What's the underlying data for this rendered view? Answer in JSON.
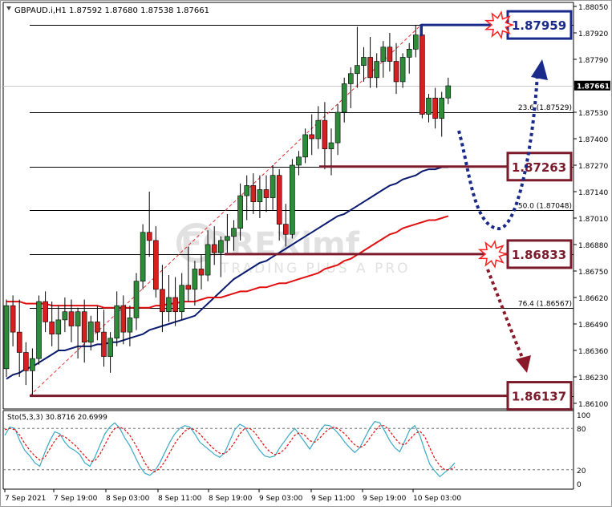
{
  "header": {
    "symbol": "GBPAUD.i,H1",
    "ohlc": "1.87592 1.87680 1.87538 1.87661"
  },
  "watermark": {
    "logo": "FOREXimf",
    "tagline": "TRADING PLUS A PRO"
  },
  "colors": {
    "bull_candle": "#2e8b3a",
    "bear_candle": "#d42020",
    "ma_fast": "#0a1a6e",
    "ma_slow": "#e01010",
    "stoch_main": "#3aa9c4",
    "stoch_signal": "#e01010",
    "box_blue": "#1a2a8a",
    "box_maroon": "#7a1a2a",
    "arrow_blue": "#1a2a8a",
    "arrow_maroon": "#8a1a2a",
    "grid_line": "#000000"
  },
  "chart_data": {
    "type": "candlestick",
    "symbol": "GBPAUD.i",
    "timeframe": "H1",
    "ylim": [
      1.86092,
      1.8805
    ],
    "y_ticks": [
      "1.88050",
      "1.87920",
      "1.87790",
      "1.87661",
      "1.87530",
      "1.87400",
      "1.87270",
      "1.87140",
      "1.87010",
      "1.86880",
      "1.86750",
      "1.86620",
      "1.86490",
      "1.86360",
      "1.86230",
      "1.86100"
    ],
    "x_ticks": [
      "7 Sep 2021",
      "7 Sep 19:00",
      "8 Sep 03:00",
      "8 Sep 11:00",
      "8 Sep 19:00",
      "9 Sep 03:00",
      "9 Sep 11:00",
      "9 Sep 19:00",
      "10 Sep 03:00"
    ],
    "last_price": "1.87661",
    "price_lines": [
      1.87959,
      1.87529,
      1.87263,
      1.87048,
      1.86833,
      1.86567,
      1.86137
    ],
    "fibonacci": [
      {
        "label": "23.6 (1.87529)",
        "value": 1.87529
      },
      {
        "label": "50.0 (1.87048)",
        "value": 1.87048
      },
      {
        "label": "76.4 (1.86567)",
        "value": 1.86567
      }
    ],
    "levels": [
      {
        "label": "1.87959",
        "value": 1.87959,
        "color": "#1a2a8a",
        "starburst": true
      },
      {
        "label": "1.87263",
        "value": 1.87263,
        "color": "#7a1a2a",
        "starburst": false
      },
      {
        "label": "1.86833",
        "value": 1.86833,
        "color": "#7a1a2a",
        "starburst": true
      },
      {
        "label": "1.86137",
        "value": 1.86137,
        "color": "#7a1a2a",
        "starburst": false
      }
    ],
    "candles": [
      [
        1.8627,
        1.8661,
        1.8623,
        1.8658
      ],
      [
        1.8658,
        1.8663,
        1.8638,
        1.8645
      ],
      [
        1.8645,
        1.8661,
        1.8623,
        1.8635
      ],
      [
        1.8635,
        1.864,
        1.8619,
        1.8626
      ],
      [
        1.8626,
        1.8637,
        1.8614,
        1.8632
      ],
      [
        1.8632,
        1.8663,
        1.8629,
        1.866
      ],
      [
        1.866,
        1.8665,
        1.8645,
        1.865
      ],
      [
        1.865,
        1.866,
        1.8638,
        1.8644
      ],
      [
        1.8644,
        1.8658,
        1.8636,
        1.8651
      ],
      [
        1.8651,
        1.8662,
        1.8645,
        1.8655
      ],
      [
        1.8655,
        1.8661,
        1.864,
        1.8648
      ],
      [
        1.8648,
        1.8657,
        1.8632,
        1.8655
      ],
      [
        1.8655,
        1.8661,
        1.863,
        1.864
      ],
      [
        1.864,
        1.8653,
        1.8636,
        1.865
      ],
      [
        1.865,
        1.8658,
        1.8641,
        1.8645
      ],
      [
        1.8645,
        1.8656,
        1.8628,
        1.8633
      ],
      [
        1.8633,
        1.8645,
        1.8625,
        1.8642
      ],
      [
        1.8642,
        1.8665,
        1.8638,
        1.8658
      ],
      [
        1.8658,
        1.8663,
        1.8639,
        1.8645
      ],
      [
        1.8645,
        1.8658,
        1.8638,
        1.8652
      ],
      [
        1.8652,
        1.8674,
        1.8646,
        1.867
      ],
      [
        1.867,
        1.8698,
        1.8666,
        1.8694
      ],
      [
        1.8694,
        1.8714,
        1.8682,
        1.869
      ],
      [
        1.869,
        1.8697,
        1.8662,
        1.8666
      ],
      [
        1.8666,
        1.8678,
        1.8645,
        1.8655
      ],
      [
        1.8655,
        1.8673,
        1.865,
        1.8662
      ],
      [
        1.8662,
        1.8672,
        1.8648,
        1.8655
      ],
      [
        1.8655,
        1.8674,
        1.8651,
        1.8668
      ],
      [
        1.8668,
        1.8687,
        1.866,
        1.8666
      ],
      [
        1.8666,
        1.868,
        1.8658,
        1.8676
      ],
      [
        1.8676,
        1.8683,
        1.8666,
        1.8673
      ],
      [
        1.8673,
        1.8695,
        1.867,
        1.8688
      ],
      [
        1.8688,
        1.8697,
        1.8678,
        1.8684
      ],
      [
        1.8684,
        1.8692,
        1.8672,
        1.869
      ],
      [
        1.869,
        1.8703,
        1.8684,
        1.8692
      ],
      [
        1.8692,
        1.87,
        1.8685,
        1.8696
      ],
      [
        1.8696,
        1.8718,
        1.869,
        1.8712
      ],
      [
        1.8712,
        1.8722,
        1.87,
        1.8717
      ],
      [
        1.8717,
        1.8723,
        1.8703,
        1.8709
      ],
      [
        1.8709,
        1.8722,
        1.8701,
        1.8715
      ],
      [
        1.8715,
        1.8722,
        1.8704,
        1.8711
      ],
      [
        1.8711,
        1.8727,
        1.8705,
        1.8722
      ],
      [
        1.8722,
        1.8725,
        1.869,
        1.8698
      ],
      [
        1.8698,
        1.8708,
        1.8687,
        1.8693
      ],
      [
        1.8693,
        1.873,
        1.8691,
        1.8727
      ],
      [
        1.8727,
        1.8734,
        1.8722,
        1.8731
      ],
      [
        1.8731,
        1.8745,
        1.8728,
        1.8742
      ],
      [
        1.8742,
        1.8752,
        1.8732,
        1.874
      ],
      [
        1.874,
        1.8756,
        1.8735,
        1.8749
      ],
      [
        1.8749,
        1.8758,
        1.8725,
        1.8735
      ],
      [
        1.8735,
        1.8745,
        1.8722,
        1.8738
      ],
      [
        1.8738,
        1.8757,
        1.8732,
        1.8753
      ],
      [
        1.8753,
        1.877,
        1.8748,
        1.8767
      ],
      [
        1.8767,
        1.8775,
        1.8755,
        1.8772
      ],
      [
        1.8772,
        1.8795,
        1.8765,
        1.8776
      ],
      [
        1.8776,
        1.8785,
        1.8768,
        1.878
      ],
      [
        1.878,
        1.879,
        1.8765,
        1.877
      ],
      [
        1.877,
        1.8782,
        1.8765,
        1.8778
      ],
      [
        1.8778,
        1.8788,
        1.877,
        1.8785
      ],
      [
        1.8785,
        1.8792,
        1.8773,
        1.8778
      ],
      [
        1.8778,
        1.8787,
        1.8762,
        1.8768
      ],
      [
        1.8768,
        1.8782,
        1.8765,
        1.878
      ],
      [
        1.878,
        1.8787,
        1.8772,
        1.8784
      ],
      [
        1.8784,
        1.8796,
        1.878,
        1.8791
      ],
      [
        1.8791,
        1.8796,
        1.875,
        1.8752
      ],
      [
        1.8752,
        1.8762,
        1.8748,
        1.876
      ],
      [
        1.876,
        1.8765,
        1.8745,
        1.875
      ],
      [
        1.875,
        1.8763,
        1.8741,
        1.876
      ],
      [
        1.876,
        1.877,
        1.8757,
        1.8766
      ]
    ],
    "series": [
      {
        "values": [
          1.8622,
          1.8624,
          1.8625,
          1.8627,
          1.8628,
          1.863,
          1.8632,
          1.8634,
          1.8636,
          1.8636,
          1.8637,
          1.8638,
          1.8638,
          1.8638,
          1.8639,
          1.8639,
          1.864,
          1.864,
          1.8641,
          1.8642,
          1.8643,
          1.8644,
          1.8646,
          1.8647,
          1.8648,
          1.8649,
          1.865,
          1.8651,
          1.8652,
          1.8653,
          1.8656,
          1.8659,
          1.8662,
          1.8665,
          1.8668,
          1.8671,
          1.8673,
          1.8675,
          1.8677,
          1.8679,
          1.868,
          1.8682,
          1.8684,
          1.8686,
          1.8688,
          1.869,
          1.8692,
          1.8694,
          1.8696,
          1.8698,
          1.87,
          1.8702,
          1.8703,
          1.8705,
          1.8707,
          1.8709,
          1.8711,
          1.8713,
          1.8715,
          1.8717,
          1.8718,
          1.872,
          1.8721,
          1.8722,
          1.8724,
          1.8725,
          1.8725,
          1.8726,
          1.8726
        ]
      },
      {
        "values": [
          1.866,
          1.866,
          1.866,
          1.8659,
          1.8659,
          1.8659,
          1.8659,
          1.8658,
          1.8658,
          1.8658,
          1.8658,
          1.8658,
          1.8658,
          1.8658,
          1.8658,
          1.8657,
          1.8657,
          1.8657,
          1.8657,
          1.8657,
          1.8657,
          1.8657,
          1.8657,
          1.8658,
          1.8658,
          1.8659,
          1.8659,
          1.866,
          1.866,
          1.866,
          1.8661,
          1.8662,
          1.8662,
          1.8662,
          1.8663,
          1.8664,
          1.8665,
          1.8665,
          1.8666,
          1.8667,
          1.8667,
          1.8668,
          1.8669,
          1.8669,
          1.867,
          1.8671,
          1.8672,
          1.8673,
          1.8674,
          1.8676,
          1.8677,
          1.8678,
          1.868,
          1.8681,
          1.8683,
          1.8685,
          1.8687,
          1.8689,
          1.8691,
          1.8693,
          1.8694,
          1.8696,
          1.8697,
          1.8698,
          1.8699,
          1.87,
          1.87,
          1.8701,
          1.8702
        ]
      }
    ],
    "stochastic": {
      "label": "Sto(5,3,3) 30.8716 20.6999",
      "ylim": [
        0,
        100
      ],
      "ticks": [
        "100",
        "80",
        "20",
        "0"
      ],
      "levels": [
        80,
        20
      ],
      "main": [
        70,
        82,
        80,
        62,
        48,
        40,
        30,
        25,
        45,
        62,
        75,
        72,
        60,
        52,
        48,
        42,
        30,
        25,
        38,
        55,
        72,
        82,
        88,
        80,
        66,
        55,
        40,
        25,
        15,
        12,
        18,
        30,
        45,
        60,
        72,
        80,
        84,
        82,
        72,
        60,
        54,
        48,
        42,
        38,
        45,
        62,
        78,
        86,
        82,
        70,
        58,
        48,
        40,
        38,
        40,
        52,
        62,
        72,
        80,
        70,
        60,
        50,
        62,
        76,
        85,
        84,
        78,
        70,
        60,
        52,
        45,
        52,
        66,
        80,
        90,
        88,
        76,
        62,
        52,
        46,
        62,
        78,
        84,
        70,
        48,
        28,
        18,
        10,
        16,
        22,
        30
      ],
      "signal": [
        78,
        80,
        78,
        70,
        58,
        48,
        40,
        34,
        38,
        50,
        62,
        70,
        68,
        62,
        56,
        48,
        40,
        32,
        33,
        42,
        56,
        70,
        80,
        82,
        78,
        70,
        58,
        45,
        30,
        20,
        17,
        22,
        32,
        45,
        58,
        68,
        76,
        80,
        78,
        72,
        64,
        56,
        49,
        44,
        43,
        50,
        60,
        72,
        80,
        80,
        74,
        64,
        54,
        46,
        42,
        44,
        50,
        60,
        70,
        74,
        70,
        62,
        60,
        66,
        74,
        80,
        82,
        78,
        72,
        64,
        56,
        52,
        56,
        66,
        76,
        84,
        84,
        76,
        66,
        58,
        56,
        64,
        72,
        76,
        68,
        52,
        36,
        26,
        20,
        20,
        24
      ]
    }
  }
}
